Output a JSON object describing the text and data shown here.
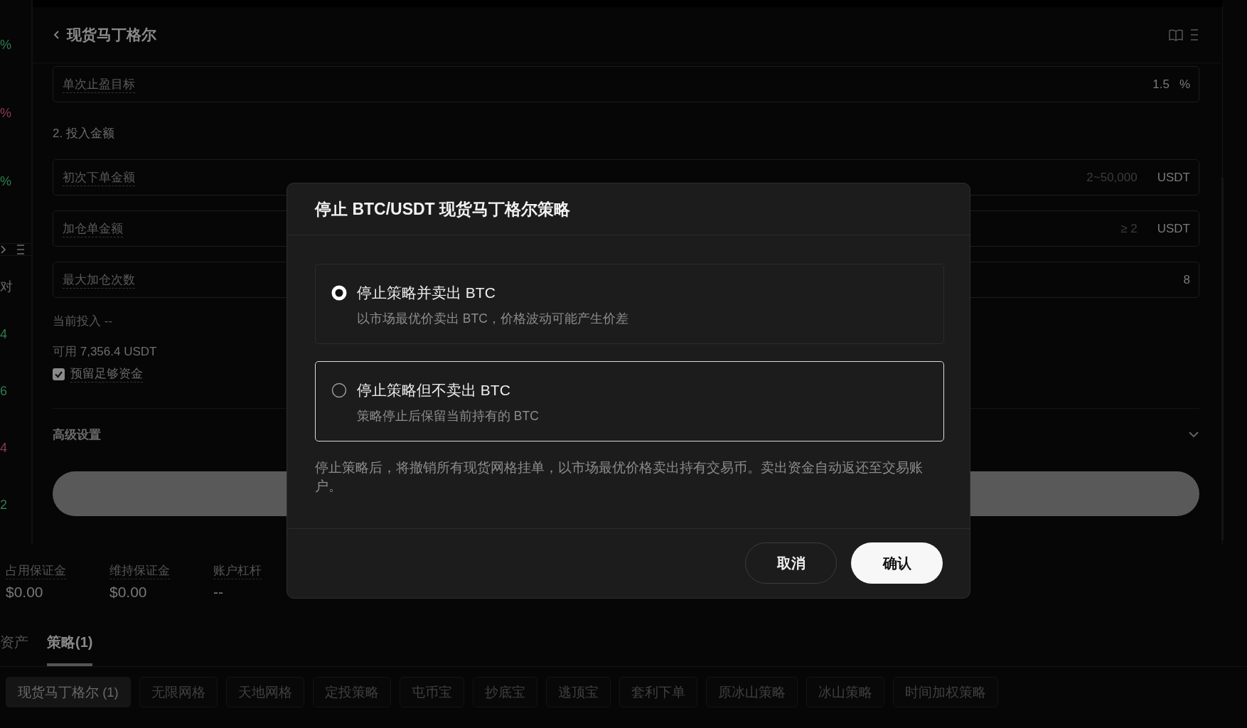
{
  "sidebar_fragments": [
    {
      "text": "%",
      "color": "#2f7d50"
    },
    {
      "text": "%",
      "color": "#8a3a52"
    },
    {
      "text": "%",
      "color": "#2f7d50"
    },
    {
      "text": "对",
      "color": "#6a6a6a"
    },
    {
      "text": "4",
      "color": "#2f7d50"
    },
    {
      "text": "6",
      "color": "#2f7d50"
    },
    {
      "text": "4",
      "color": "#8a3a52"
    },
    {
      "text": "2",
      "color": "#2f7d50"
    }
  ],
  "panel": {
    "title": "现货马丁格尔",
    "fields": [
      {
        "label": "单次止盈目标",
        "value": "1.5",
        "unit": "%"
      }
    ],
    "section": "2. 投入金额",
    "amount_fields": [
      {
        "label": "初次下单金额",
        "placeholder": "2~50,000",
        "unit": "USDT"
      },
      {
        "label": "加仓单金额",
        "placeholder": "≥ 2",
        "unit": "USDT"
      },
      {
        "label": "最大加仓次数",
        "value": "8"
      }
    ],
    "current_investment": "当前投入 --",
    "available": {
      "label": "可用",
      "value": "7,356.4 USDT"
    },
    "reserve_funds": {
      "label": "预留足够资金",
      "checked": true
    },
    "advanced_settings": {
      "label": "高级设置",
      "expanded": false
    }
  },
  "account_stats": [
    {
      "label": "占用保证金",
      "value": "$0.00"
    },
    {
      "label": "维持保证金",
      "value": "$0.00"
    },
    {
      "label": "账户杠杆",
      "value": "--"
    }
  ],
  "tabs": [
    {
      "label": "资产",
      "selected": false
    },
    {
      "label": "策略(1)",
      "selected": true
    }
  ],
  "strategy_filters": [
    {
      "label": "现货马丁格尔 (1)",
      "selected": true
    },
    {
      "label": "无限网格",
      "selected": false
    },
    {
      "label": "天地网格",
      "selected": false
    },
    {
      "label": "定投策略",
      "selected": false
    },
    {
      "label": "屯币宝",
      "selected": false
    },
    {
      "label": "抄底宝",
      "selected": false
    },
    {
      "label": "逃顶宝",
      "selected": false
    },
    {
      "label": "套利下单",
      "selected": false
    },
    {
      "label": "原冰山策略",
      "selected": false
    },
    {
      "label": "冰山策略",
      "selected": false
    },
    {
      "label": "时间加权策略",
      "selected": false
    }
  ],
  "dialog": {
    "title": "停止 BTC/USDT 现货马丁格尔策略",
    "options": [
      {
        "title": "停止策略并卖出 BTC",
        "description": "以市场最优价卖出 BTC，价格波动可能产生价差",
        "selected": true,
        "focused": false
      },
      {
        "title": "停止策略但不卖出 BTC",
        "description": "策略停止后保留当前持有的 BTC",
        "selected": false,
        "focused": true
      }
    ],
    "note": "停止策略后，将撤销所有现货网格挂单，以市场最优价格卖出持有交易币。卖出资金自动返还至交易账户。",
    "buttons": [
      {
        "label": "取消",
        "kind": "secondary"
      },
      {
        "label": "确认",
        "kind": "primary"
      }
    ]
  }
}
